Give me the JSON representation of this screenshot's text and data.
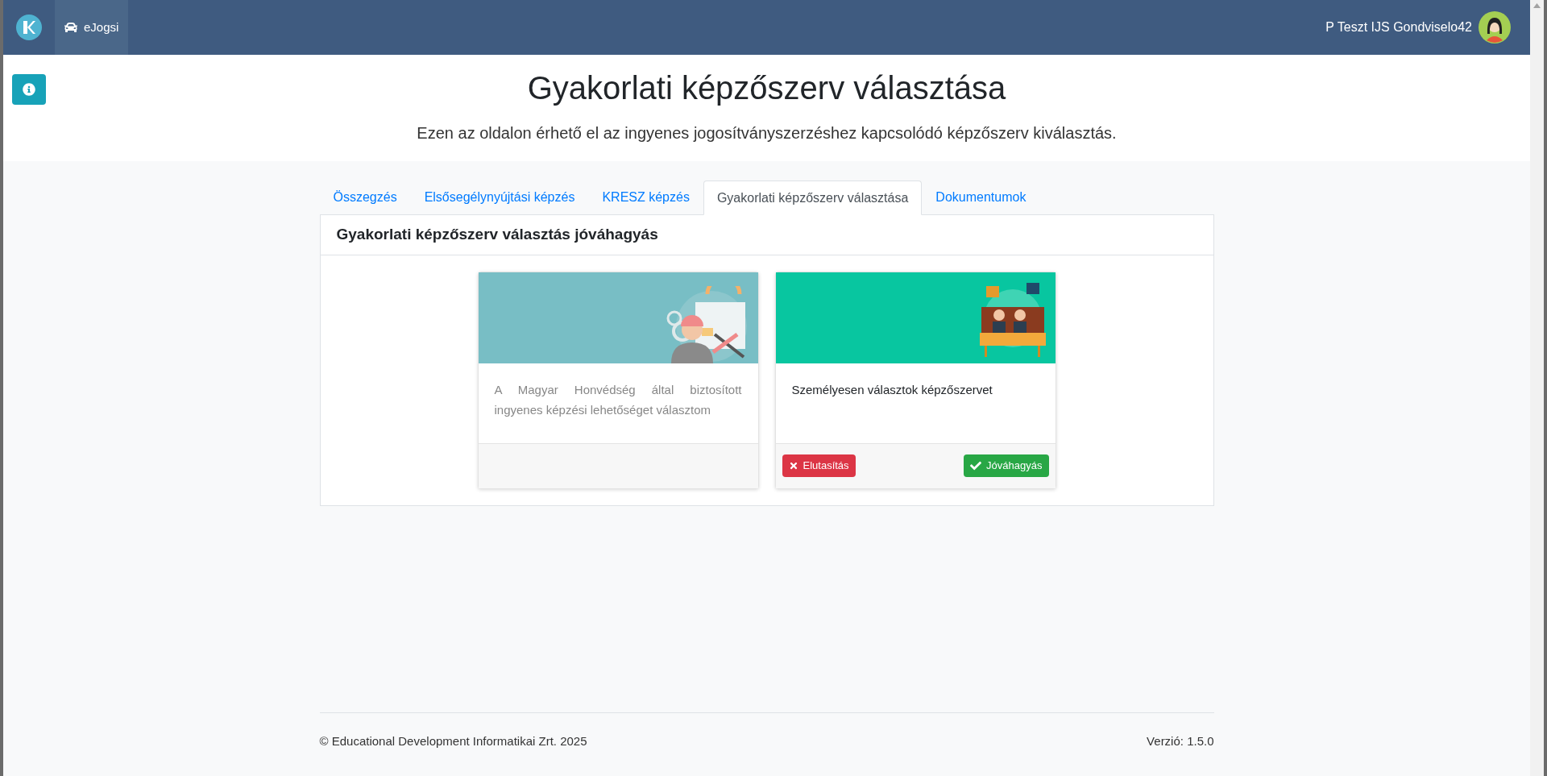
{
  "navbar": {
    "brand_app": "eJogsi",
    "user_name": "P Teszt IJS Gondviselo42"
  },
  "page": {
    "title": "Gyakorlati képzőszerv választása",
    "subtitle": "Ezen az oldalon érhető el az ingyenes jogosítványszerzéshez kapcsolódó képzőszerv kiválasztás."
  },
  "tabs": [
    {
      "label": "Összegzés",
      "selected": false
    },
    {
      "label": "Elsősegélynyújtási képzés",
      "selected": false
    },
    {
      "label": "KRESZ képzés",
      "selected": false
    },
    {
      "label": "Gyakorlati képzőszerv választása",
      "selected": true
    },
    {
      "label": "Dokumentumok",
      "selected": false
    }
  ],
  "panel": {
    "title": "Gyakorlati képzőszerv választás jóváhagyás",
    "cards": [
      {
        "kind": "engineer",
        "text": "A Magyar Honvédség által biztosított ingyenes képzési lehetőséget választom",
        "disabled": true
      },
      {
        "kind": "classroom",
        "text": "Személyesen választok képzőszervet",
        "disabled": false,
        "buttons": [
          {
            "kind": "reject",
            "label": "Elutasítás"
          },
          {
            "kind": "approve",
            "label": "Jóváhagyás"
          }
        ]
      }
    ]
  },
  "footer": {
    "copyright": "© Educational Development Informatikai Zrt. 2025",
    "version": "Verzió: 1.5.0"
  }
}
